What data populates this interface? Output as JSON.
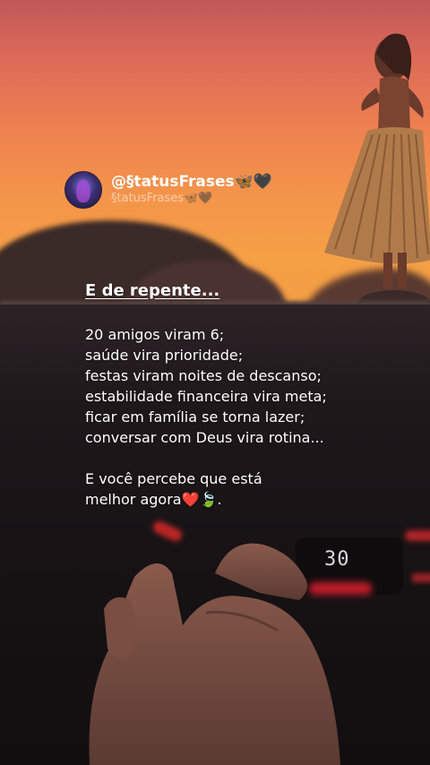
{
  "post": {
    "display_name": "@§tatusFrases🦋🖤",
    "handle": "§tatusFrases🦋🖤",
    "avatar_icon": "avatar-icon"
  },
  "quote": {
    "title": "E de repente...",
    "lines": [
      "20 amigos viram 6;",
      "saúde vira prioridade;",
      "festas viram noites de descanso;",
      "estabilidade financeira vira meta;",
      "ficar em família se torna lazer;",
      "conversar com Deus vira rotina..."
    ],
    "closing": [
      "E você percebe que está",
      "melhor agora❤️🍃."
    ]
  },
  "background": {
    "dashboard_display": "30",
    "colors": {
      "sky_top": "#c0585a",
      "sky_bottom": "#f29c45",
      "dashboard": "#171214",
      "accent_red": "#e02030"
    }
  }
}
